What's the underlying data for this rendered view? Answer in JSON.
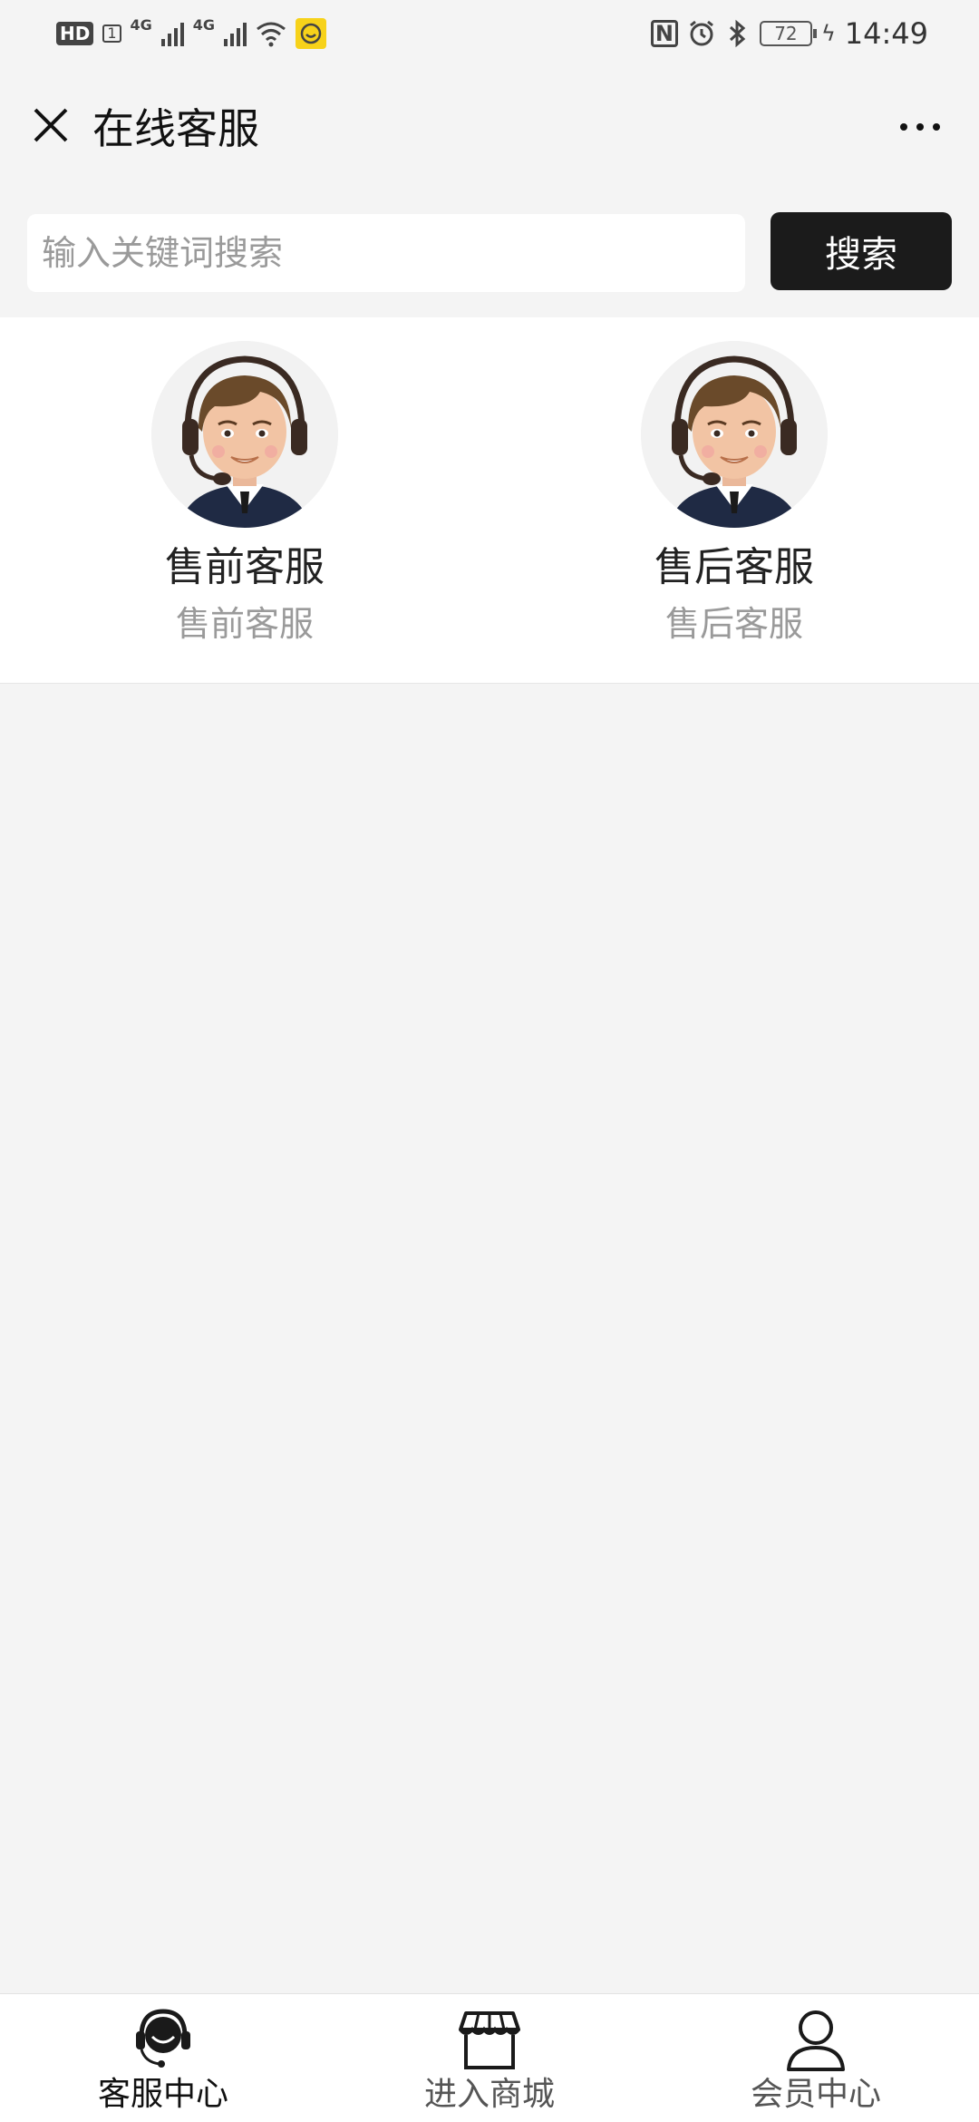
{
  "status_bar": {
    "hd": "HD",
    "sim": "1",
    "net1": "4G",
    "net2": "4G",
    "battery": "72",
    "time": "14:49",
    "icons": [
      "wifi-icon",
      "app-notification-icon",
      "nfc-icon",
      "alarm-icon",
      "bluetooth-icon",
      "charging-icon"
    ]
  },
  "header": {
    "title": "在线客服",
    "close_icon": "close-icon",
    "more_icon": "more-dots-icon"
  },
  "search": {
    "placeholder": "输入关键词搜索",
    "value": "",
    "button_label": "搜索"
  },
  "agents": [
    {
      "name": "售前客服",
      "description": "售前客服"
    },
    {
      "name": "售后客服",
      "description": "售后客服"
    }
  ],
  "tab_bar": {
    "active_index": 0,
    "tabs": [
      {
        "label": "客服中心",
        "icon": "headset-agent-icon"
      },
      {
        "label": "进入商城",
        "icon": "store-icon"
      },
      {
        "label": "会员中心",
        "icon": "user-icon"
      }
    ]
  },
  "colors": {
    "page_bg": "#f4f4f4",
    "panel_bg": "#ffffff",
    "button_bg": "#1b1b1b",
    "muted_text": "#9a9a9a"
  }
}
